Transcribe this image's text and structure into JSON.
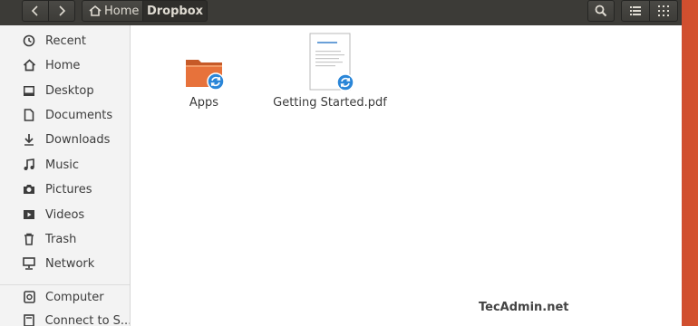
{
  "toolbar": {
    "back_icon": "chevron-left-icon",
    "forward_icon": "chevron-right-icon",
    "breadcrumb_home": "Home",
    "breadcrumb_current": "Dropbox",
    "search_icon": "search-icon",
    "list_view_icon": "list-view-icon",
    "grid_view_icon": "grid-view-icon"
  },
  "sidebar": {
    "items": [
      {
        "label": "Recent",
        "icon": "clock-icon"
      },
      {
        "label": "Home",
        "icon": "home-icon"
      },
      {
        "label": "Desktop",
        "icon": "desktop-icon"
      },
      {
        "label": "Documents",
        "icon": "document-icon"
      },
      {
        "label": "Downloads",
        "icon": "download-icon"
      },
      {
        "label": "Music",
        "icon": "music-icon"
      },
      {
        "label": "Pictures",
        "icon": "camera-icon"
      },
      {
        "label": "Videos",
        "icon": "video-icon"
      },
      {
        "label": "Trash",
        "icon": "trash-icon"
      },
      {
        "label": "Network",
        "icon": "network-icon"
      }
    ],
    "bottom_items": [
      {
        "label": "Computer",
        "icon": "computer-icon"
      },
      {
        "label": "Connect to S...",
        "icon": "server-icon"
      }
    ]
  },
  "files": [
    {
      "name": "Apps",
      "type": "folder",
      "sync_icon": "sync-icon"
    },
    {
      "name": "Getting Started.pdf",
      "type": "pdf",
      "sync_icon": "sync-icon"
    }
  ],
  "watermark": "TecAdmin.net",
  "colors": {
    "header_bg": "#3c3b37",
    "folder_orange": "#e7723b",
    "sync_blue": "#2a86d8"
  }
}
